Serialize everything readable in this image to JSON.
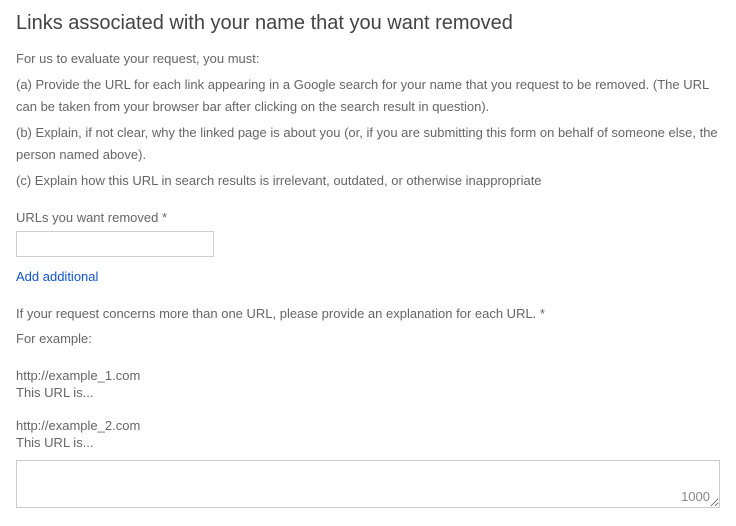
{
  "heading": "Links associated with your name that you want removed",
  "intro": "For us to evaluate your request, you must:",
  "bullets": {
    "a": "(a) Provide the URL for each link appearing in a Google search for your name that you request to be removed. (The URL can be taken from your browser bar after clicking on the search result in question).",
    "b": "(b) Explain, if not clear, why the linked page is about you (or, if you are submitting this form on behalf of someone else, the person named above).",
    "c": "(c) Explain how this URL in search results is irrelevant, outdated, or otherwise inappropriate"
  },
  "urls_label": "URLs you want removed *",
  "url_value": "",
  "add_additional": "Add additional",
  "explanation_label": "If your request concerns more than one URL, please provide an explanation for each URL. *",
  "for_example": "For example:",
  "example1_url": "http://example_1.com",
  "example1_text": "This URL is...",
  "example2_url": "http://example_2.com",
  "example2_text": "This URL is...",
  "textarea_value": "",
  "char_count": "1000"
}
